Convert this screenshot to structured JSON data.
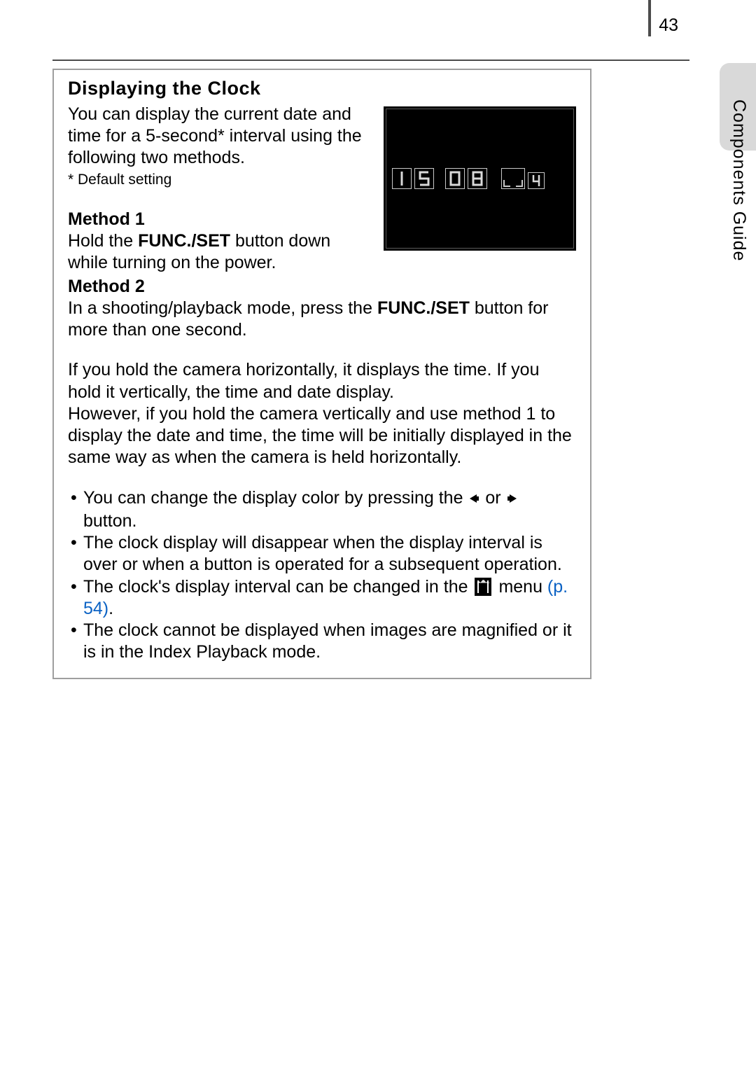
{
  "page_number": "43",
  "side_tab": "Components Guide",
  "section": {
    "title": "Displaying the Clock",
    "intro": "You can display the current date and time for a 5-second* interval using the following two methods.",
    "footnote": "* Default setting",
    "method1_heading": "Method 1",
    "method1_pre": "Hold the ",
    "method1_button": "FUNC./SET",
    "method1_post": " button down while turning on the power.",
    "method2_heading": "Method 2",
    "method2_pre": "In a shooting/playback mode, press the ",
    "method2_button": "FUNC./SET",
    "method2_post": " button for more than one second.",
    "orientation_para": "If you hold the camera horizontally, it displays the time. If you hold it vertically, the time and date display.\nHowever, if you hold the camera vertically and use method 1 to display the date and time, the time will be initially displayed in the same way as when the camera is held horizontally.",
    "bullets": {
      "b1_pre": "You can change the display color by pressing the ",
      "b1_mid": " or ",
      "b1_post": " button.",
      "b2": "The clock display will disappear when the display interval is over or when a button is operated for a subsequent operation.",
      "b3_pre": "The clock's display interval can be changed in the ",
      "b3_post": " menu ",
      "b3_link": "(p. 54)",
      "b3_end": ".",
      "b4": "The clock cannot be displayed when images are magnified or it is in the Index Playback mode."
    }
  },
  "clock_display": {
    "digits": [
      "1",
      "5",
      "0",
      "8"
    ],
    "seconds_small": "4"
  }
}
